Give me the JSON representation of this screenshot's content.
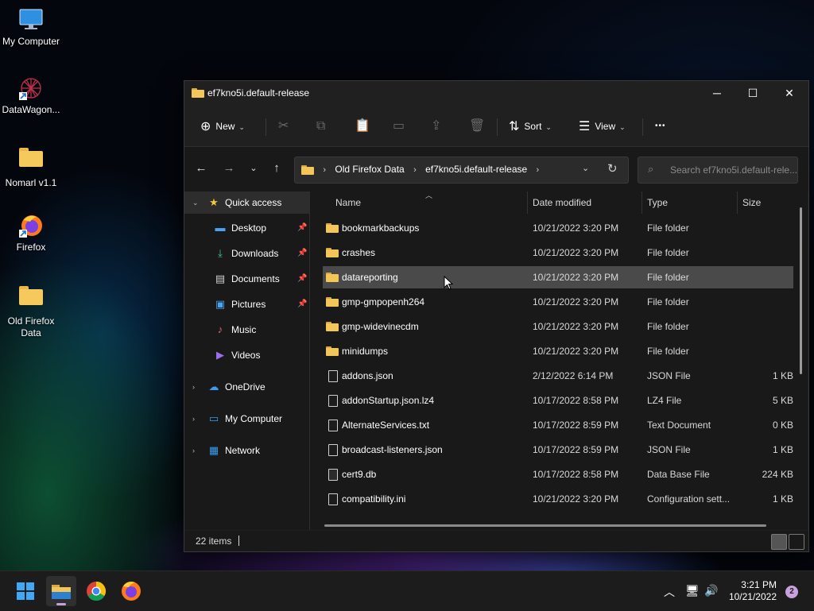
{
  "desktop": {
    "icons": [
      {
        "label": "My Computer",
        "icon": "monitor-icon"
      },
      {
        "label": "DataWagon...",
        "icon": "datawagon-icon"
      },
      {
        "label": "Nomarl v1.1",
        "icon": "folder-icon"
      },
      {
        "label": "Firefox",
        "icon": "firefox-icon"
      },
      {
        "label": "Old Firefox\nData",
        "label_line1": "Old Firefox",
        "label_line2": "Data",
        "icon": "folder-icon"
      }
    ]
  },
  "window": {
    "title": "ef7kno5i.default-release",
    "controls": {
      "minimize": "─",
      "maximize": "☐",
      "close": "✕"
    }
  },
  "toolbar": {
    "new_label": "New",
    "sort_label": "Sort",
    "view_label": "View",
    "more_label": "•••"
  },
  "address": {
    "crumbs": [
      "Old Firefox Data",
      "ef7kno5i.default-release"
    ],
    "search_placeholder": "Search ef7kno5i.default-rele..."
  },
  "nav": {
    "quick_access": "Quick access",
    "items": [
      {
        "label": "Desktop",
        "pinned": true
      },
      {
        "label": "Downloads",
        "pinned": true
      },
      {
        "label": "Documents",
        "pinned": true
      },
      {
        "label": "Pictures",
        "pinned": true
      },
      {
        "label": "Music",
        "pinned": false
      },
      {
        "label": "Videos",
        "pinned": false
      }
    ],
    "onedrive": "OneDrive",
    "my_computer": "My Computer",
    "network": "Network"
  },
  "columns": {
    "name": "Name",
    "date": "Date modified",
    "type": "Type",
    "size": "Size"
  },
  "files": [
    {
      "name": "bookmarkbackups",
      "date": "10/21/2022 3:20 PM",
      "type": "File folder",
      "size": "",
      "kind": "folder"
    },
    {
      "name": "crashes",
      "date": "10/21/2022 3:20 PM",
      "type": "File folder",
      "size": "",
      "kind": "folder"
    },
    {
      "name": "datareporting",
      "date": "10/21/2022 3:20 PM",
      "type": "File folder",
      "size": "",
      "kind": "folder"
    },
    {
      "name": "gmp-gmpopenh264",
      "date": "10/21/2022 3:20 PM",
      "type": "File folder",
      "size": "",
      "kind": "folder"
    },
    {
      "name": "gmp-widevinecdm",
      "date": "10/21/2022 3:20 PM",
      "type": "File folder",
      "size": "",
      "kind": "folder"
    },
    {
      "name": "minidumps",
      "date": "10/21/2022 3:20 PM",
      "type": "File folder",
      "size": "",
      "kind": "folder"
    },
    {
      "name": "addons.json",
      "date": "2/12/2022 6:14 PM",
      "type": "JSON File",
      "size": "1 KB",
      "kind": "file"
    },
    {
      "name": "addonStartup.json.lz4",
      "date": "10/17/2022 8:58 PM",
      "type": "LZ4 File",
      "size": "5 KB",
      "kind": "file"
    },
    {
      "name": "AlternateServices.txt",
      "date": "10/17/2022 8:59 PM",
      "type": "Text Document",
      "size": "0 KB",
      "kind": "file"
    },
    {
      "name": "broadcast-listeners.json",
      "date": "10/17/2022 8:59 PM",
      "type": "JSON File",
      "size": "1 KB",
      "kind": "file"
    },
    {
      "name": "cert9.db",
      "date": "10/17/2022 8:58 PM",
      "type": "Data Base File",
      "size": "224 KB",
      "kind": "db"
    },
    {
      "name": "compatibility.ini",
      "date": "10/21/2022 3:20 PM",
      "type": "Configuration sett...",
      "size": "1 KB",
      "kind": "ini"
    }
  ],
  "status": {
    "item_count": "22 items"
  },
  "taskbar": {
    "time": "3:21 PM",
    "date": "10/21/2022",
    "notifications": "2"
  }
}
